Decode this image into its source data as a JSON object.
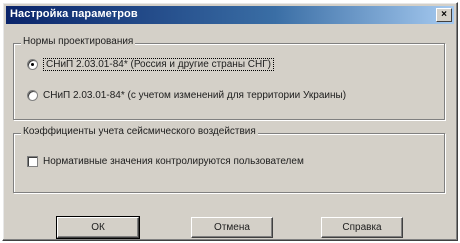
{
  "window": {
    "title": "Настройка параметров",
    "close_glyph": "×"
  },
  "norms_group": {
    "label": "Нормы проектирования",
    "options": [
      {
        "label": "СНиП 2.03.01-84* (Россия и другие страны СНГ)",
        "selected": true
      },
      {
        "label": "СНиП 2.03.01-84* (с учетом изменений для территории Украины)",
        "selected": false
      }
    ]
  },
  "coef_group": {
    "label": "Коэффициенты учета сейсмического воздействия",
    "checkbox": {
      "label": "Нормативные значения контролируются пользователем",
      "checked": false
    }
  },
  "buttons": {
    "ok": "ОК",
    "cancel": "Отмена",
    "help": "Справка"
  }
}
